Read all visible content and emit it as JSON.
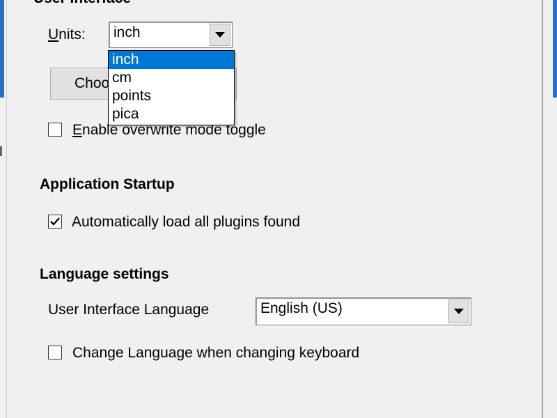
{
  "user_interface": {
    "title": "User Interface",
    "units_label": "Units:",
    "units_value": "inch",
    "units_options": [
      "inch",
      "cm",
      "points",
      "pica"
    ],
    "button_label": "Choo",
    "overwrite_label": "Enable overwrite mode toggle",
    "overwrite_checked": false
  },
  "startup": {
    "title": "Application Startup",
    "autoload_label": "Automatically load all plugins found",
    "autoload_checked": true
  },
  "language": {
    "title": "Language settings",
    "ui_language_label": "User Interface Language",
    "ui_language_value": "English (US)",
    "change_on_keyboard_label": "Change Language when changing keyboard",
    "change_on_keyboard_checked": false
  },
  "colors": {
    "highlight": "#0078d7",
    "window_edge_accent": "#2b6cc4"
  }
}
